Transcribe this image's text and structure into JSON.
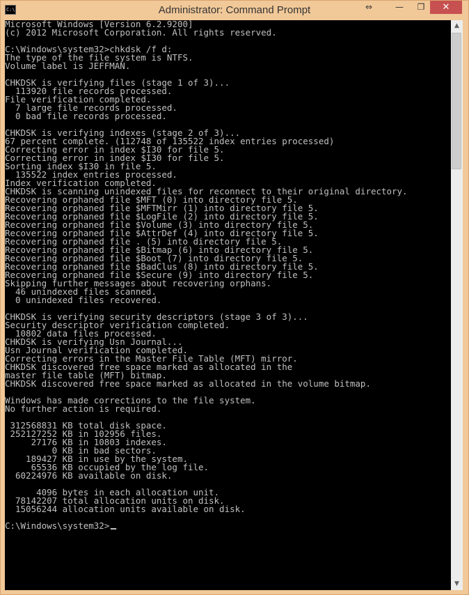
{
  "window": {
    "title": "Administrator: Command Prompt",
    "icon_text": "C:\\.",
    "buttons": {
      "resize_icon": "⇔",
      "minimize_icon": "—",
      "maximize_icon": "❐",
      "close_icon": "✕"
    },
    "colors": {
      "frame": "#f1c898",
      "close": "#c75050",
      "console_bg": "#000000",
      "console_text": "#c0c0c0"
    }
  },
  "console": {
    "lines": [
      "Microsoft Windows [Version 6.2.9200]",
      "(c) 2012 Microsoft Corporation. All rights reserved.",
      "",
      "C:\\Windows\\system32>chkdsk /f d:",
      "The type of the file system is NTFS.",
      "Volume label is JEFFMAN.",
      "",
      "CHKDSK is verifying files (stage 1 of 3)...",
      "  113920 file records processed.",
      "File verification completed.",
      "  7 large file records processed.",
      "  0 bad file records processed.",
      "",
      "CHKDSK is verifying indexes (stage 2 of 3)...",
      "67 percent complete. (112748 of 135522 index entries processed)",
      "Correcting error in index $I30 for file 5.",
      "Correcting error in index $I30 for file 5.",
      "Sorting index $I30 in file 5.",
      "  135522 index entries processed.",
      "Index verification completed.",
      "CHKDSK is scanning unindexed files for reconnect to their original directory.",
      "Recovering orphaned file $MFT (0) into directory file 5.",
      "Recovering orphaned file $MFTMirr (1) into directory file 5.",
      "Recovering orphaned file $LogFile (2) into directory file 5.",
      "Recovering orphaned file $Volume (3) into directory file 5.",
      "Recovering orphaned file $AttrDef (4) into directory file 5.",
      "Recovering orphaned file . (5) into directory file 5.",
      "Recovering orphaned file $Bitmap (6) into directory file 5.",
      "Recovering orphaned file $Boot (7) into directory file 5.",
      "Recovering orphaned file $BadClus (8) into directory file 5.",
      "Recovering orphaned file $Secure (9) into directory file 5.",
      "Skipping further messages about recovering orphans.",
      "  46 unindexed files scanned.",
      "  0 unindexed files recovered.",
      "",
      "CHKDSK is verifying security descriptors (stage 3 of 3)...",
      "Security descriptor verification completed.",
      "  10802 data files processed.",
      "CHKDSK is verifying Usn Journal...",
      "Usn Journal verification completed.",
      "Correcting errors in the Master File Table (MFT) mirror.",
      "CHKDSK discovered free space marked as allocated in the",
      "master file table (MFT) bitmap.",
      "CHKDSK discovered free space marked as allocated in the volume bitmap.",
      "",
      "Windows has made corrections to the file system.",
      "No further action is required.",
      "",
      " 312568831 KB total disk space.",
      " 252127252 KB in 102956 files.",
      "     27176 KB in 10803 indexes.",
      "         0 KB in bad sectors.",
      "    189427 KB in use by the system.",
      "     65536 KB occupied by the log file.",
      "  60224976 KB available on disk.",
      "",
      "      4096 bytes in each allocation unit.",
      "  78142207 total allocation units on disk.",
      "  15056244 allocation units available on disk.",
      ""
    ],
    "prompt": "C:\\Windows\\system32>"
  },
  "scrollbar": {
    "up_icon": "▲",
    "down_icon": "▼"
  }
}
